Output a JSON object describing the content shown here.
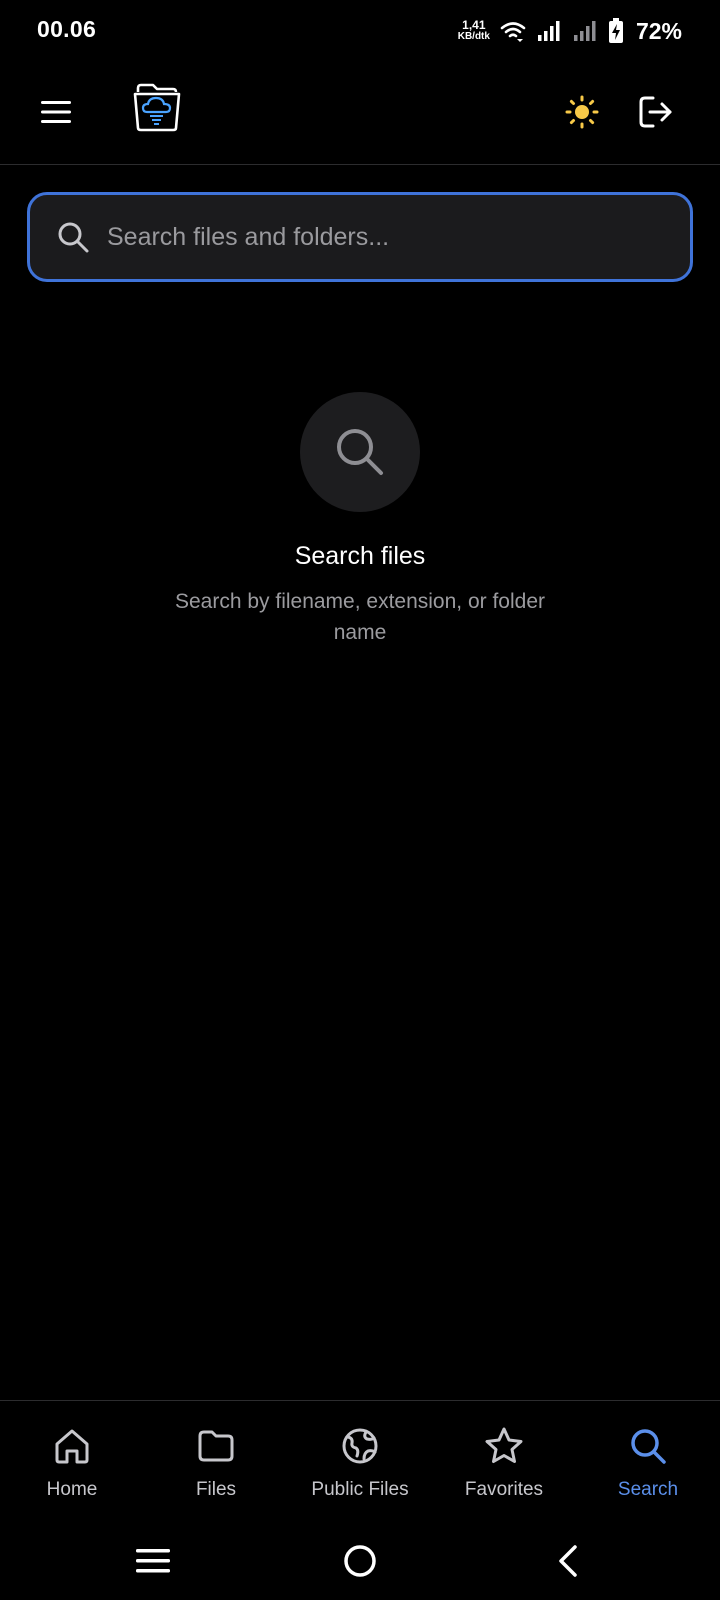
{
  "status_bar": {
    "time": "00.06",
    "net_speed_value": "1,41",
    "net_speed_unit": "KB/dtk",
    "battery": "72%"
  },
  "app_bar": {
    "icons": [
      "menu-icon",
      "cloud-folder-logo",
      "sun-icon",
      "logout-icon"
    ],
    "theme_icon_color": "#f7c948"
  },
  "search": {
    "placeholder": "Search files and folders...",
    "value": "",
    "border_color": "#3f73d9"
  },
  "empty_state": {
    "icon": "search-icon",
    "title": "Search files",
    "subtitle": "Search by filename, extension, or folder name"
  },
  "bottom_nav": {
    "items": [
      {
        "label": "Home",
        "icon": "home-icon"
      },
      {
        "label": "Files",
        "icon": "folder-icon"
      },
      {
        "label": "Public Files",
        "icon": "globe-icon"
      },
      {
        "label": "Favorites",
        "icon": "star-icon"
      },
      {
        "label": "Search",
        "icon": "search-icon"
      }
    ],
    "active": "Search",
    "active_color": "#5b8fea"
  },
  "system_nav": {
    "icons": [
      "recents-icon",
      "home-circle-icon",
      "back-icon"
    ]
  }
}
